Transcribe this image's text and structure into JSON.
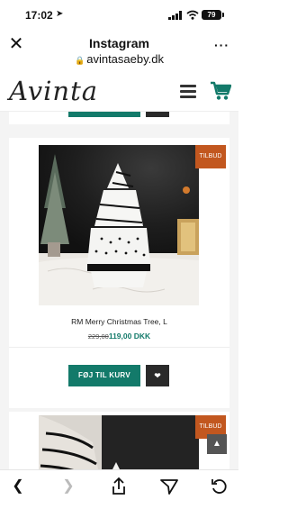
{
  "status": {
    "time": "17:02",
    "battery": "79"
  },
  "browser": {
    "title": "Instagram",
    "url": "avintasaeby.dk"
  },
  "site": {
    "logo": "Avinta"
  },
  "product": {
    "badge": "TILBUD",
    "name": "RM Merry Christmas Tree, L",
    "old_price": "229,00",
    "new_price": "119,00 DKK",
    "add_to_cart": "FØJ TIL KURV"
  },
  "next_product": {
    "badge": "TILBUD"
  },
  "colors": {
    "accent": "#137a6a",
    "badge": "#c2571f",
    "dark": "#2a2a2a"
  },
  "icons": {
    "close": "close-icon",
    "more": "more-icon",
    "menu": "hamburger-icon",
    "cart": "cart-icon",
    "heart": "heart-icon",
    "back": "back-icon",
    "forward": "forward-icon",
    "share": "share-icon",
    "send": "send-icon",
    "refresh": "refresh-icon",
    "scroll_top": "chevron-up-icon"
  }
}
